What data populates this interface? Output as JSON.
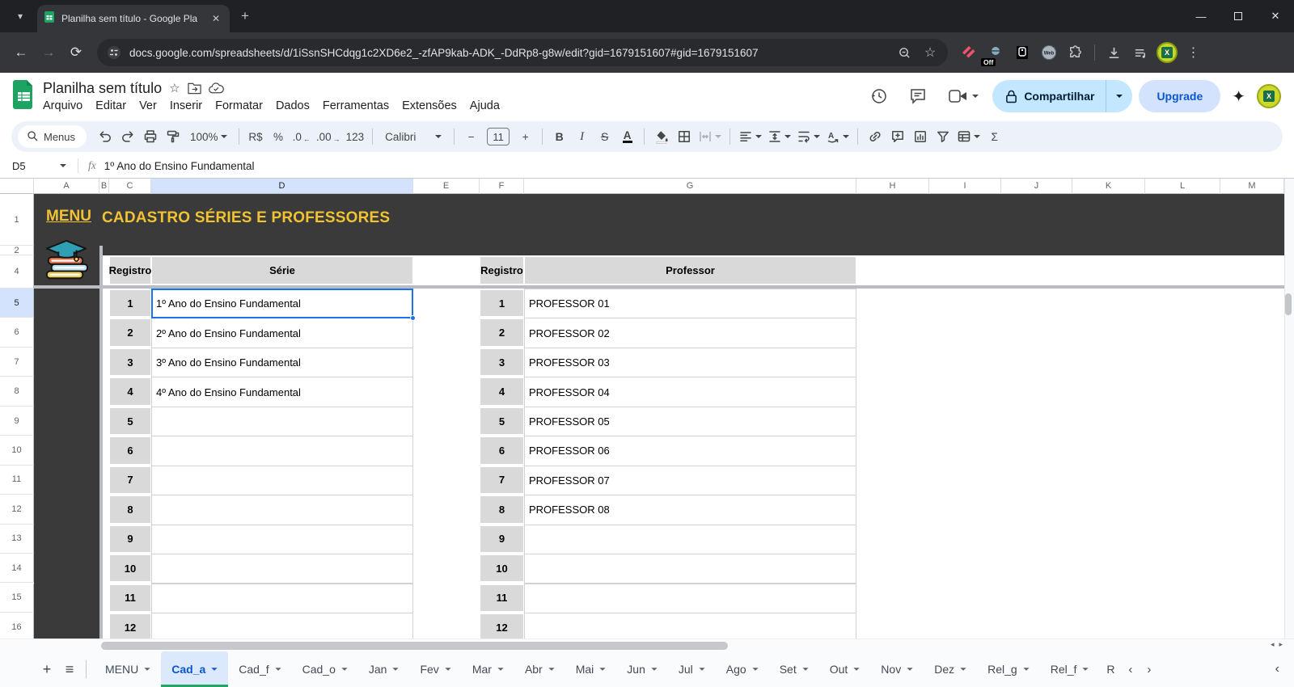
{
  "browser": {
    "tab": {
      "title": "Planilha sem título - Google Pla"
    },
    "url": "docs.google.com/spreadsheets/d/1iSsnSHCdqg1c2XD6e2_-zfAP9kab-ADK_-DdRp8-g8w/edit?gid=1679151607#gid=1679151607",
    "extension_badge": "Off",
    "web_badge": "Web"
  },
  "header": {
    "title": "Planilha sem título",
    "menus": [
      "Arquivo",
      "Editar",
      "Ver",
      "Inserir",
      "Formatar",
      "Dados",
      "Ferramentas",
      "Extensões",
      "Ajuda"
    ],
    "share_label": "Compartilhar",
    "upgrade_label": "Upgrade"
  },
  "toolbar": {
    "items": [
      {
        "name": "menus-search",
        "kind": "search",
        "label": "Menus"
      },
      {
        "name": "undo-button",
        "kind": "icon",
        "icon": "undo"
      },
      {
        "name": "redo-button",
        "kind": "icon",
        "icon": "redo"
      },
      {
        "name": "print-button",
        "kind": "icon",
        "icon": "print"
      },
      {
        "name": "paint-format-button",
        "kind": "icon",
        "icon": "roller"
      },
      {
        "name": "zoom-select",
        "kind": "textdd",
        "label": "100%"
      },
      {
        "name": "sep1",
        "kind": "sep"
      },
      {
        "name": "format-currency-button",
        "kind": "text",
        "label": "R$"
      },
      {
        "name": "format-percent-button",
        "kind": "text",
        "label": "%"
      },
      {
        "name": "decrease-decimals-button",
        "kind": "text",
        "label": ".0",
        "sub": "←"
      },
      {
        "name": "increase-decimals-button",
        "kind": "text",
        "label": ".00",
        "sub": "→"
      },
      {
        "name": "more-formats-button",
        "kind": "text",
        "label": "123"
      },
      {
        "name": "sep2",
        "kind": "sep"
      },
      {
        "name": "font-select",
        "kind": "fontdd",
        "label": "Calibri"
      },
      {
        "name": "sep3",
        "kind": "sep"
      },
      {
        "name": "decrease-font-size-button",
        "kind": "text",
        "label": "−"
      },
      {
        "name": "font-size-field",
        "kind": "boxed",
        "label": "11"
      },
      {
        "name": "increase-font-size-button",
        "kind": "text",
        "label": "+"
      },
      {
        "name": "sep4",
        "kind": "sep"
      },
      {
        "name": "bold-button",
        "kind": "text",
        "label": "B",
        "cls": "bB"
      },
      {
        "name": "italic-button",
        "kind": "text",
        "label": "I",
        "cls": "bI"
      },
      {
        "name": "strikethrough-button",
        "kind": "text",
        "label": "S",
        "cls": "bS"
      },
      {
        "name": "text-color-button",
        "kind": "text",
        "label": "A",
        "cls": "bA"
      },
      {
        "name": "sep5",
        "kind": "sep"
      },
      {
        "name": "fill-color-button",
        "kind": "icon",
        "icon": "fill"
      },
      {
        "name": "borders-button",
        "kind": "icon",
        "icon": "borders"
      },
      {
        "name": "merge-cells-button",
        "kind": "icondd",
        "icon": "merge",
        "disabled": true
      },
      {
        "name": "sep6",
        "kind": "sep"
      },
      {
        "name": "horizontal-align-button",
        "kind": "icondd",
        "icon": "alignleft"
      },
      {
        "name": "vertical-align-button",
        "kind": "icondd",
        "icon": "valign"
      },
      {
        "name": "text-wrap-button",
        "kind": "icondd",
        "icon": "wrap"
      },
      {
        "name": "text-rotation-button",
        "kind": "icondd",
        "icon": "rotate"
      },
      {
        "name": "sep7",
        "kind": "sep"
      },
      {
        "name": "insert-link-button",
        "kind": "icon",
        "icon": "link"
      },
      {
        "name": "insert-comment-button",
        "kind": "icon",
        "icon": "comment"
      },
      {
        "name": "insert-chart-button",
        "kind": "icon",
        "icon": "chart"
      },
      {
        "name": "create-filter-button",
        "kind": "icon",
        "icon": "filter"
      },
      {
        "name": "table-views-button",
        "kind": "icondd",
        "icon": "tableview"
      },
      {
        "name": "functions-button",
        "kind": "text",
        "label": "Σ"
      }
    ]
  },
  "formula_bar": {
    "cell_ref": "D5",
    "fx": "fx",
    "value": "1º Ano do Ensino Fundamental"
  },
  "grid": {
    "columns": [
      "A",
      "B",
      "C",
      "D",
      "E",
      "F",
      "G",
      "H",
      "I",
      "J",
      "K",
      "L",
      "M"
    ],
    "row_labels": [
      "1",
      "2",
      "4",
      "5",
      "6",
      "7",
      "8",
      "9",
      "10",
      "11",
      "12",
      "13",
      "14",
      "15",
      "16"
    ],
    "selected": {
      "col": "D",
      "row_label": "5"
    },
    "title": {
      "menu_link": "MENU",
      "heading": "CADASTRO SÉRIES E PROFESSORES"
    },
    "table_series": {
      "headers": [
        "Registro",
        "Série"
      ],
      "rows": [
        [
          "1",
          "1º Ano do Ensino Fundamental"
        ],
        [
          "2",
          "2º Ano do Ensino Fundamental"
        ],
        [
          "3",
          "3º Ano do Ensino Fundamental"
        ],
        [
          "4",
          "4º Ano do Ensino Fundamental"
        ],
        [
          "5",
          ""
        ],
        [
          "6",
          ""
        ],
        [
          "7",
          ""
        ],
        [
          "8",
          ""
        ],
        [
          "9",
          ""
        ],
        [
          "10",
          ""
        ],
        [
          "11",
          ""
        ],
        [
          "12",
          ""
        ]
      ]
    },
    "table_professors": {
      "headers": [
        "Registro",
        "Professor"
      ],
      "rows": [
        [
          "1",
          "PROFESSOR 01"
        ],
        [
          "2",
          "PROFESSOR 02"
        ],
        [
          "3",
          "PROFESSOR 03"
        ],
        [
          "4",
          "PROFESSOR 04"
        ],
        [
          "5",
          "PROFESSOR 05"
        ],
        [
          "6",
          "PROFESSOR 06"
        ],
        [
          "7",
          "PROFESSOR 07"
        ],
        [
          "8",
          "PROFESSOR 08"
        ],
        [
          "9",
          ""
        ],
        [
          "10",
          ""
        ],
        [
          "11",
          ""
        ],
        [
          "12",
          ""
        ]
      ]
    }
  },
  "sheet_tabs": {
    "tabs": [
      "MENU",
      "Cad_a",
      "Cad_f",
      "Cad_o",
      "Jan",
      "Fev",
      "Mar",
      "Abr",
      "Mai",
      "Jun",
      "Jul",
      "Ago",
      "Set",
      "Out",
      "Nov",
      "Dez",
      "Rel_g",
      "Rel_f",
      "R"
    ],
    "active": "Cad_a",
    "truncated_last": true
  },
  "colors": {
    "dark_band": "#3a3a3a",
    "title_yellow": "#f1c232",
    "header_gray": "#d9d9d9",
    "selection_blue": "#1a73e8",
    "active_tab_text": "#0b57d0",
    "active_tab_bar": "#23a566",
    "share_bg": "#c2e7ff"
  }
}
